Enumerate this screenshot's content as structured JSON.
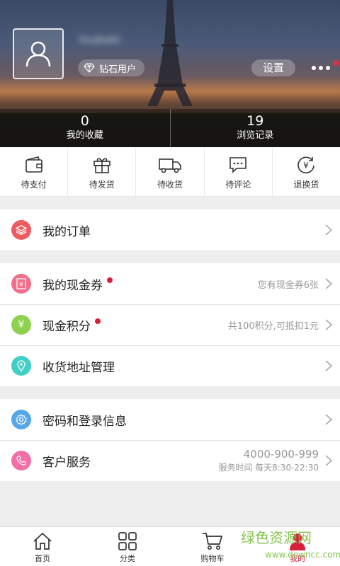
{
  "profile": {
    "username": "tsubaki",
    "vip_label": "钻石用户",
    "settings_label": "设置"
  },
  "stats": [
    {
      "num": "0",
      "label": "我的收藏"
    },
    {
      "num": "19",
      "label": "浏览记录"
    }
  ],
  "order_status": [
    {
      "label": "待支付",
      "icon": "wallet-icon"
    },
    {
      "label": "待发货",
      "icon": "gift-icon"
    },
    {
      "label": "待收货",
      "icon": "truck-icon"
    },
    {
      "label": "待评论",
      "icon": "comment-icon"
    },
    {
      "label": "退换货",
      "icon": "refund-icon"
    }
  ],
  "menu": {
    "orders": {
      "label": "我的订单",
      "color": "#ee5a5f"
    },
    "coupons": {
      "label": "我的现金券",
      "hint": "您有现金券6张",
      "color": "#f06f8a"
    },
    "points": {
      "label": "现金积分",
      "hint": "共100积分,可抵扣1元",
      "color": "#8fd14f"
    },
    "address": {
      "label": "收货地址管理",
      "color": "#3fcfc6"
    },
    "password": {
      "label": "密码和登录信息",
      "color": "#56a6ea"
    },
    "service": {
      "label": "客户服务",
      "phone": "4000-900-999",
      "hours": "服务时间  每天8:30-22:30",
      "color": "#f06fa6"
    }
  },
  "tabs": [
    {
      "label": "首页",
      "icon": "home-icon"
    },
    {
      "label": "分类",
      "icon": "grid-icon"
    },
    {
      "label": "购物车",
      "icon": "cart-icon"
    },
    {
      "label": "我的",
      "icon": "user-icon",
      "active": true
    }
  ],
  "watermark": {
    "line1": "绿色资源网",
    "line2": "www.downcc.com"
  },
  "colors": {
    "accent": "#d8203a",
    "background": "#eeeeee"
  }
}
